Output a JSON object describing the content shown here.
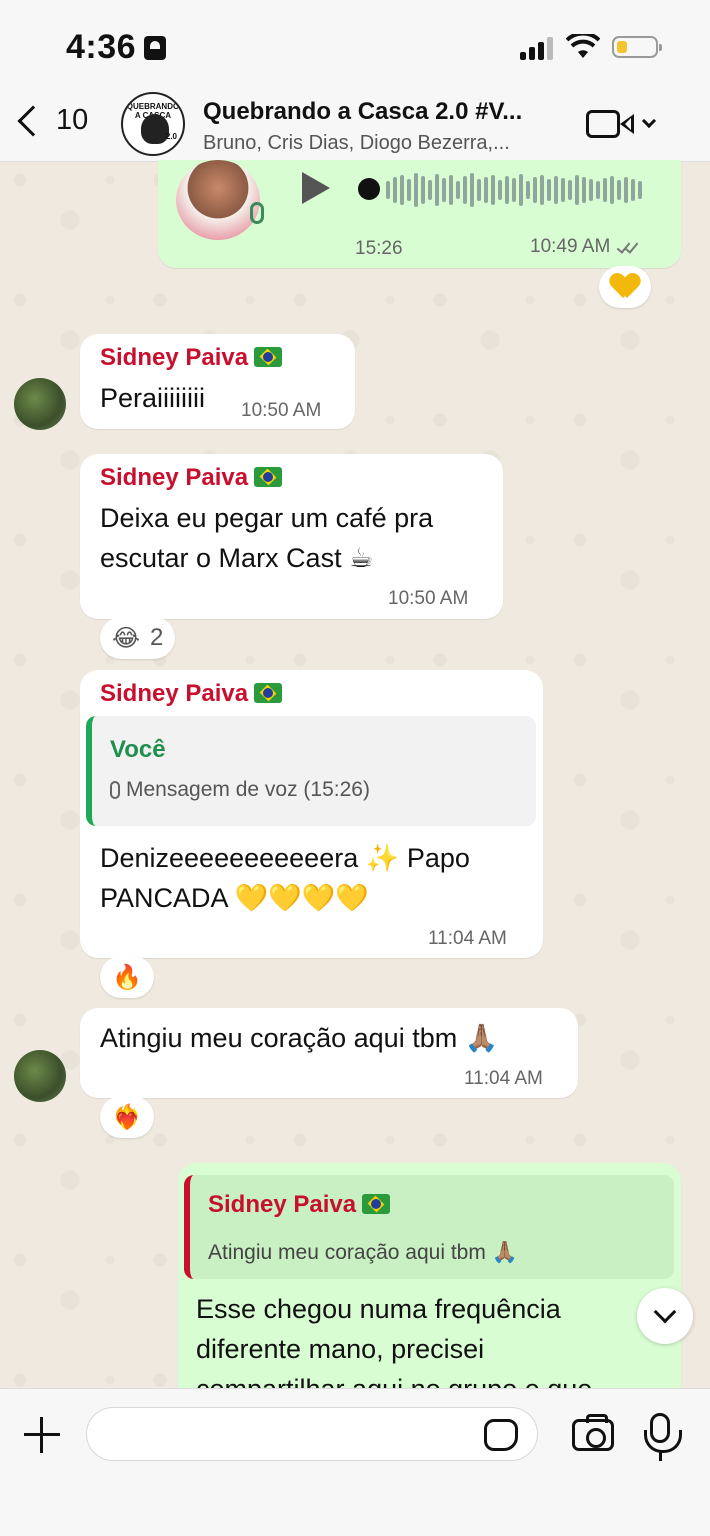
{
  "status_bar": {
    "time": "4:36"
  },
  "header": {
    "back_count": "10",
    "group_title": "Quebrando a Casca 2.0 #V...",
    "group_members": "Bruno, Cris Dias, Diogo Bezerra,...",
    "avatar_text": "QUEBRANDO A CASCA",
    "avatar_num": "2.0"
  },
  "messages": {
    "voice_out": {
      "duration": "15:26",
      "time": "10:49 AM",
      "reaction": "💛"
    },
    "m1": {
      "sender": "Sidney Paiva",
      "text": "Peraiiiiiiii",
      "time": "10:50 AM"
    },
    "m2": {
      "sender": "Sidney Paiva",
      "text_line1": "Deixa eu pegar um café pra",
      "text_line2": "escutar o Marx Cast ☕",
      "time": "10:50 AM",
      "reaction_emoji": "😂",
      "reaction_count": "2"
    },
    "m3": {
      "sender": "Sidney Paiva",
      "quote_author": "Você",
      "quote_text": "Mensagem de voz (15:26)",
      "text_line1": "Denizeeeeeeeeeeera ✨ Papo",
      "text_line2": "PANCADA 💛💛💛💛",
      "time": "11:04 AM",
      "reaction": "🔥"
    },
    "m4": {
      "text": "Atingiu meu coração aqui tbm 🙏🏽",
      "time": "11:04 AM",
      "reaction": "❤️‍🔥"
    },
    "m5": {
      "quote_author": "Sidney Paiva",
      "quote_text": "Atingiu meu coração aqui tbm 🙏🏽",
      "text_line1": "Esse chegou numa frequência",
      "text_line2": "diferente mano, precisei",
      "text_line3": "compartilhar aqui no grupo e que"
    }
  },
  "composer": {
    "placeholder": ""
  }
}
